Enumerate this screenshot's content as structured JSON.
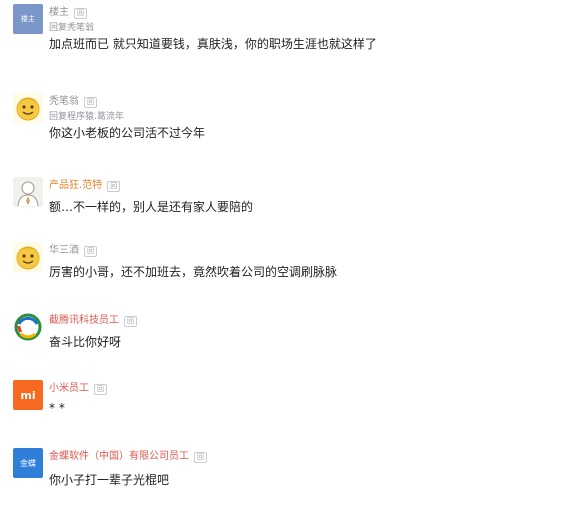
{
  "comments": [
    {
      "username": "楼主",
      "badge": "回",
      "reply_prefix": "回复",
      "reply_to": "秃笔翁",
      "text": "加点班而已 就只知道要钱，真肤浅，你的职场生涯也就这样了",
      "avatar": "blue-square-avatar"
    },
    {
      "username": "秃笔翁",
      "badge": "回",
      "reply_prefix": "回复",
      "reply_to": "程序猿.葛流年",
      "text": "你这小老板的公司活不过今年",
      "avatar": "yellow-face-avatar"
    },
    {
      "username": "产品狂.范特",
      "badge": "回",
      "text": "额…不一样的，别人是还有家人要陪的",
      "avatar": "person-avatar"
    },
    {
      "username": "华三酒",
      "badge": "回",
      "text": "厉害的小哥，还不加班去，竟然吹着公司的空调刷脉脉",
      "avatar": "yellow-face-avatar"
    },
    {
      "username": "截腾讯科技员工",
      "badge": "回",
      "text": "奋斗比你好呀",
      "avatar": "tencent-logo-avatar"
    },
    {
      "username": "小米员工",
      "badge": "回",
      "text": "* *",
      "avatar": "xiaomi-logo-avatar",
      "avatar_text": "mi"
    },
    {
      "username": "金蝶软件（中国）有限公司员工",
      "badge": "回",
      "text": "你小子打一辈子光棍吧",
      "avatar": "kingdee-logo-avatar",
      "avatar_text": "金蝶"
    }
  ],
  "colors": {
    "username_gray": "#8f949b",
    "username_orange": "#e8842a",
    "username_red": "#e0574e",
    "username_blue": "#3d79c7",
    "xiaomi_orange": "#f56a20",
    "kingdee_blue": "#2f7fd8"
  }
}
